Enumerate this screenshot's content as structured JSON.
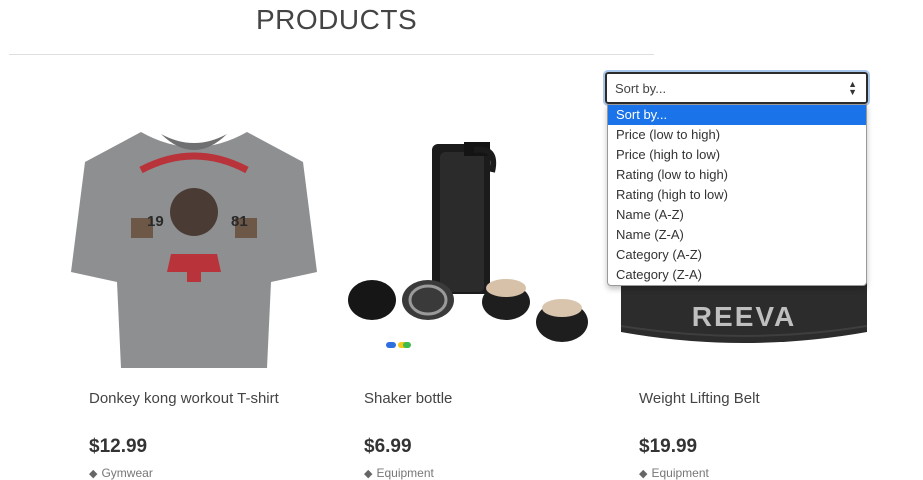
{
  "header": {
    "title": "PRODUCTS"
  },
  "sort": {
    "current": "Sort by...",
    "options": [
      "Sort by...",
      "Price (low to high)",
      "Price (high to low)",
      "Rating (low to high)",
      "Rating (high to low)",
      "Name (A-Z)",
      "Name (Z-A)",
      "Category (A-Z)",
      "Category (Z-A)"
    ],
    "selected_index": 0
  },
  "products": [
    {
      "name": "Donkey kong workout T-shirt",
      "price": "$12.99",
      "category": "Gymwear",
      "image_icon": "tshirt-image"
    },
    {
      "name": "Shaker bottle",
      "price": "$6.99",
      "category": "Equipment",
      "image_icon": "shaker-bottle-image"
    },
    {
      "name": "Weight Lifting Belt",
      "price": "$19.99",
      "category": "Equipment",
      "image_icon": "lifting-belt-image",
      "image_text": "REEVA"
    }
  ],
  "colors": {
    "highlight": "#1a73e8",
    "select_focus": "#a9c6ec",
    "text": "#333333"
  }
}
